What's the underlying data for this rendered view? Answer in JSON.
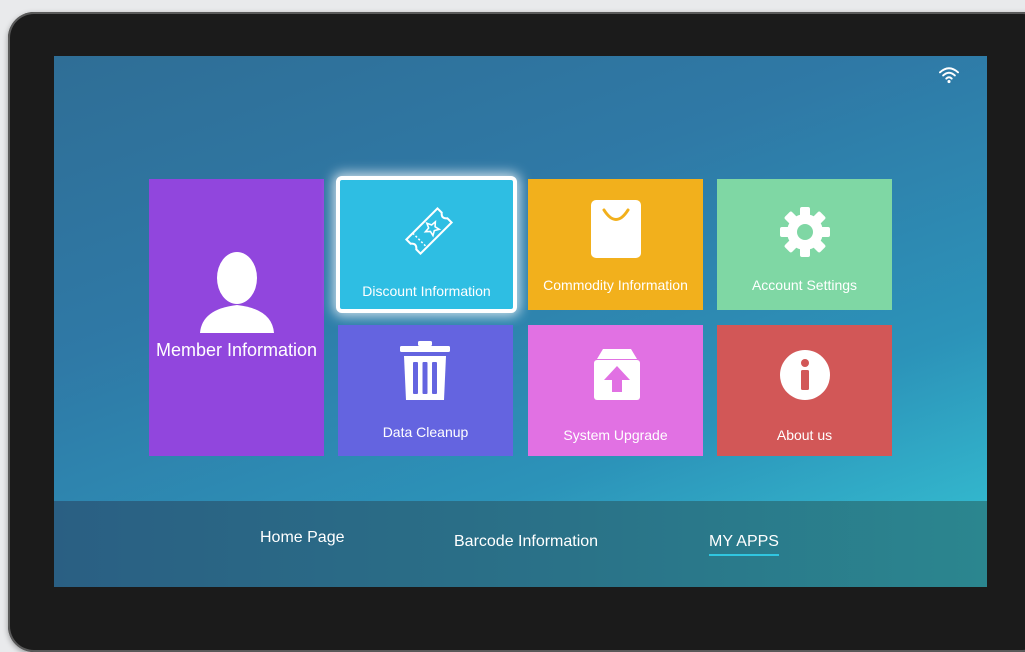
{
  "tiles": {
    "member": {
      "label": "Member Information",
      "color": "#9146dd",
      "icon": "person-icon"
    },
    "discount": {
      "label": "Discount Information",
      "color": "#2ebee3",
      "icon": "ticket-icon"
    },
    "commodity": {
      "label": "Commodity Information",
      "color": "#f2b01c",
      "icon": "shopping-bag-icon"
    },
    "account": {
      "label": "Account Settings",
      "color": "#7fd7a4",
      "icon": "gear-icon"
    },
    "cleanup": {
      "label": "Data Cleanup",
      "color": "#6464e0",
      "icon": "trash-icon"
    },
    "upgrade": {
      "label": "System Upgrade",
      "color": "#e171e3",
      "icon": "upload-box-icon"
    },
    "about": {
      "label": "About us",
      "color": "#d25757",
      "icon": "info-icon"
    }
  },
  "selected_tile": "discount",
  "status": {
    "icon": "wifi-icon"
  },
  "nav": {
    "items": [
      {
        "label": "Home Page"
      },
      {
        "label": "Barcode Information"
      },
      {
        "label": "MY APPS"
      }
    ],
    "active_index": 2,
    "active_color": "#30c6e0"
  }
}
